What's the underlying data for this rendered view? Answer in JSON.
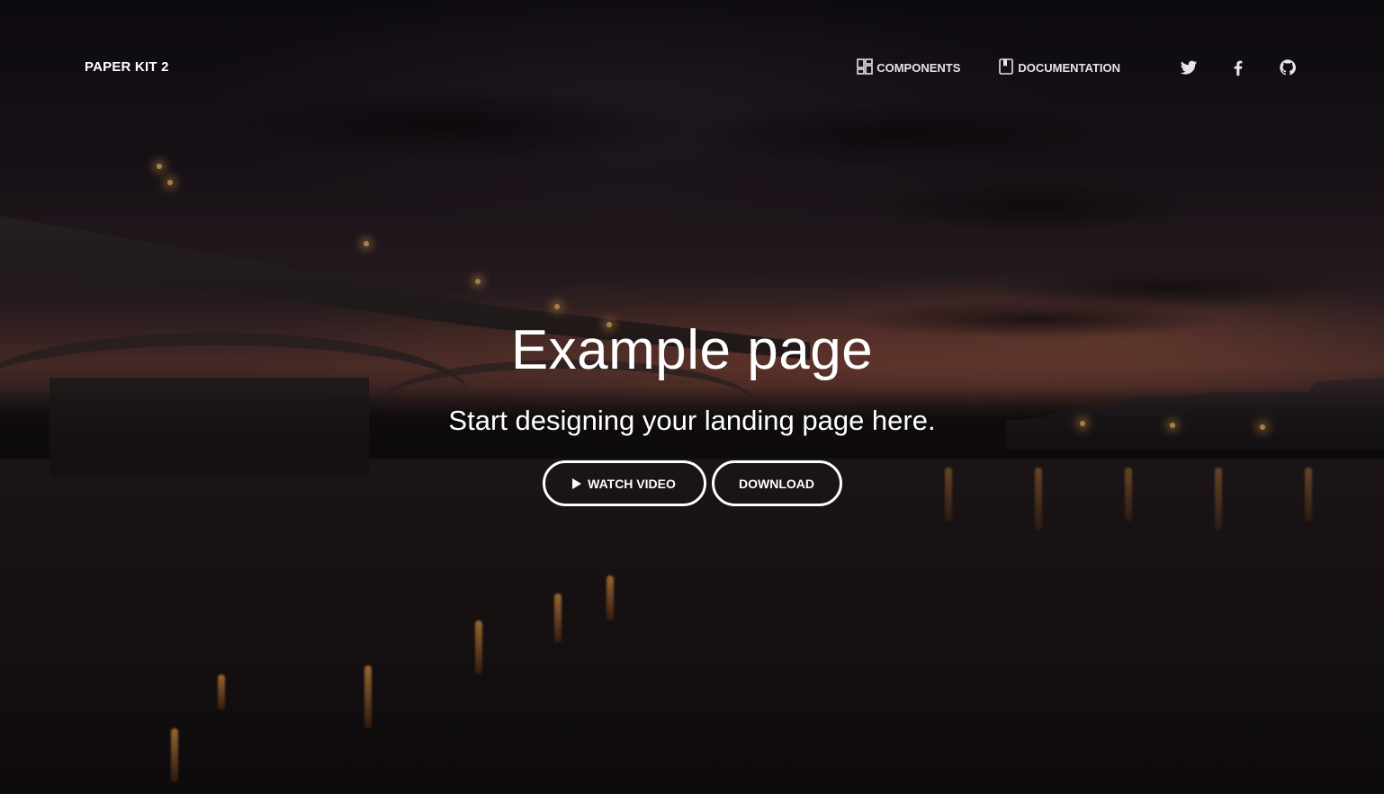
{
  "navbar": {
    "brand": "PAPER KIT 2",
    "links": {
      "components": "COMPONENTS",
      "documentation": "DOCUMENTATION"
    },
    "social": {
      "twitter_icon": "twitter-icon",
      "facebook_icon": "facebook-icon",
      "github_icon": "github-icon"
    }
  },
  "hero": {
    "title": "Example page",
    "subtitle": "Start designing your landing page here.",
    "buttons": {
      "watch_video": "WATCH VIDEO",
      "download": "DOWNLOAD"
    },
    "play_icon": "play-icon"
  },
  "colors": {
    "text": "#ffffff",
    "nav_text": "#e8e3e6",
    "button_border": "#ffffff"
  }
}
